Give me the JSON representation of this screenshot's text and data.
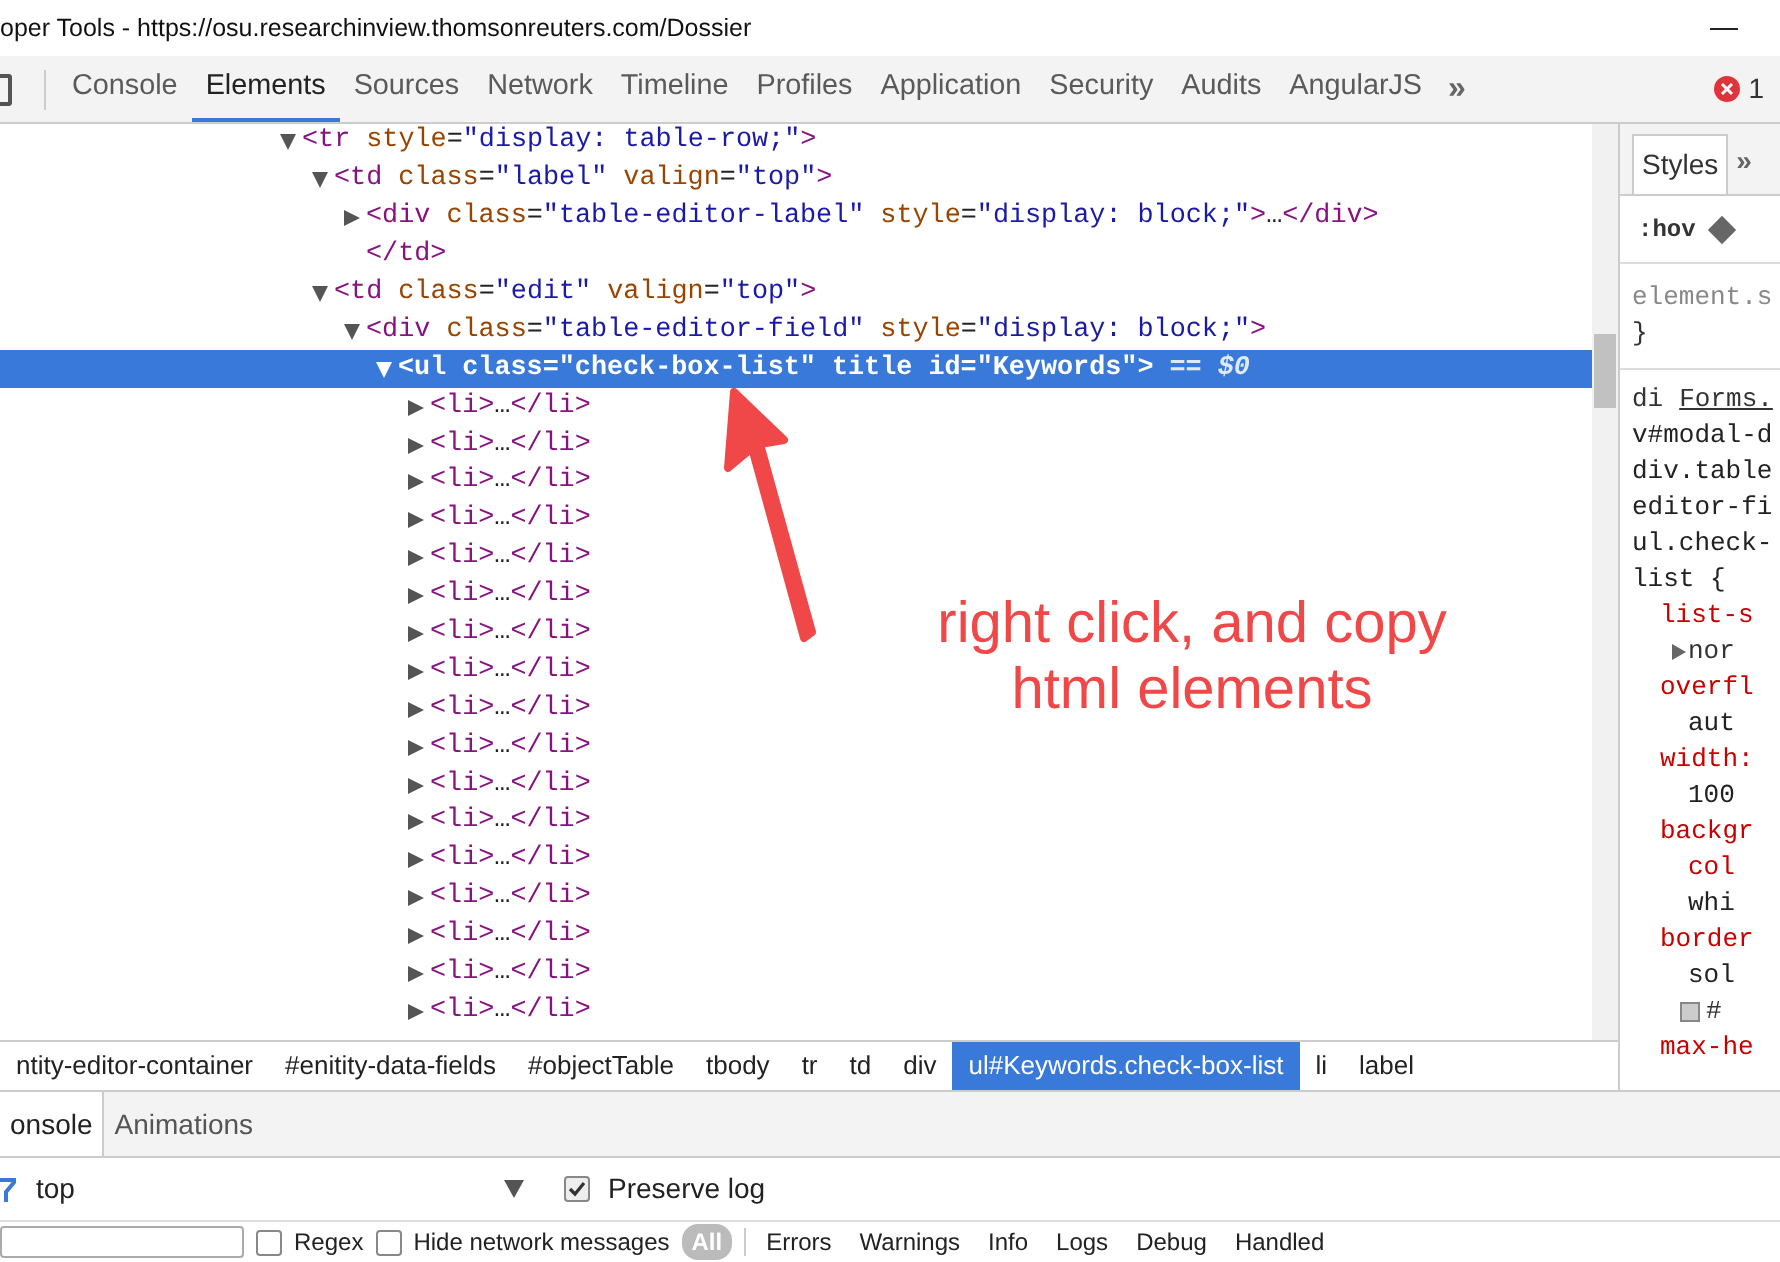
{
  "window": {
    "title": "oper Tools - https://osu.researchinview.thomsonreuters.com/Dossier"
  },
  "tabs": [
    {
      "label": "Console",
      "selected": false
    },
    {
      "label": "Elements",
      "selected": true
    },
    {
      "label": "Sources",
      "selected": false
    },
    {
      "label": "Network",
      "selected": false
    },
    {
      "label": "Timeline",
      "selected": false
    },
    {
      "label": "Profiles",
      "selected": false
    },
    {
      "label": "Application",
      "selected": false
    },
    {
      "label": "Security",
      "selected": false
    },
    {
      "label": "Audits",
      "selected": false
    },
    {
      "label": "AngularJS",
      "selected": false
    }
  ],
  "tabs_overflow": "»",
  "error_count": "1",
  "dom_tree": [
    {
      "expanded": true,
      "selected": false,
      "tokens": [
        {
          "kind": "tag",
          "text": "<tr"
        },
        {
          "kind": "attr",
          "text": " style"
        },
        {
          "kind": "punct",
          "text": "="
        },
        {
          "kind": "value",
          "text": "\"display: table-row;\""
        },
        {
          "kind": "tag",
          "text": ">"
        }
      ],
      "children": [
        {
          "expanded": true,
          "selected": false,
          "tokens": [
            {
              "kind": "tag",
              "text": "<td"
            },
            {
              "kind": "attr",
              "text": " class"
            },
            {
              "kind": "punct",
              "text": "="
            },
            {
              "kind": "value",
              "text": "\"label\""
            },
            {
              "kind": "attr",
              "text": " valign"
            },
            {
              "kind": "punct",
              "text": "="
            },
            {
              "kind": "value",
              "text": "\"top\""
            },
            {
              "kind": "tag",
              "text": ">"
            }
          ],
          "children": [
            {
              "expanded": false,
              "selected": false,
              "tokens": [
                {
                  "kind": "tag",
                  "text": "<div"
                },
                {
                  "kind": "attr",
                  "text": " class"
                },
                {
                  "kind": "punct",
                  "text": "="
                },
                {
                  "kind": "value",
                  "text": "\"table-editor-label\""
                },
                {
                  "kind": "attr",
                  "text": " style"
                },
                {
                  "kind": "punct",
                  "text": "="
                },
                {
                  "kind": "value",
                  "text": "\"display: block;\""
                },
                {
                  "kind": "tag",
                  "text": ">"
                },
                {
                  "kind": "text",
                  "text": "…"
                },
                {
                  "kind": "tag",
                  "text": "</div>"
                }
              ]
            },
            {
              "selected": false,
              "tokens": [
                {
                  "kind": "tag",
                  "text": "</td>"
                }
              ]
            }
          ]
        },
        {
          "expanded": true,
          "selected": false,
          "tokens": [
            {
              "kind": "tag",
              "text": "<td"
            },
            {
              "kind": "attr",
              "text": " class"
            },
            {
              "kind": "punct",
              "text": "="
            },
            {
              "kind": "value",
              "text": "\"edit\""
            },
            {
              "kind": "attr",
              "text": " valign"
            },
            {
              "kind": "punct",
              "text": "="
            },
            {
              "kind": "value",
              "text": "\"top\""
            },
            {
              "kind": "tag",
              "text": ">"
            }
          ],
          "children": [
            {
              "expanded": true,
              "selected": false,
              "tokens": [
                {
                  "kind": "tag",
                  "text": "<div"
                },
                {
                  "kind": "attr",
                  "text": " class"
                },
                {
                  "kind": "punct",
                  "text": "="
                },
                {
                  "kind": "value",
                  "text": "\"table-editor-field\""
                },
                {
                  "kind": "attr",
                  "text": " style"
                },
                {
                  "kind": "punct",
                  "text": "="
                },
                {
                  "kind": "value",
                  "text": "\"display: block;\""
                },
                {
                  "kind": "tag",
                  "text": ">"
                }
              ],
              "children": [
                {
                  "expanded": true,
                  "selected": true,
                  "tokens": [
                    {
                      "kind": "tag",
                      "text": "<ul"
                    },
                    {
                      "kind": "attr",
                      "text": " class"
                    },
                    {
                      "kind": "punct",
                      "text": "="
                    },
                    {
                      "kind": "value",
                      "text": "\"check-box-list\""
                    },
                    {
                      "kind": "attr",
                      "text": " title id"
                    },
                    {
                      "kind": "punct",
                      "text": "="
                    },
                    {
                      "kind": "value",
                      "text": "\"Keywords\""
                    },
                    {
                      "kind": "tag",
                      "text": ">"
                    },
                    {
                      "kind": "ghost",
                      "text": " == $0"
                    }
                  ],
                  "children": [
                    {
                      "expanded": false,
                      "selected": false,
                      "tokens": [
                        {
                          "kind": "tag",
                          "text": "<li>"
                        },
                        {
                          "kind": "text",
                          "text": "…"
                        },
                        {
                          "kind": "tag",
                          "text": "</li>"
                        }
                      ]
                    },
                    {
                      "expanded": false,
                      "selected": false,
                      "tokens": [
                        {
                          "kind": "tag",
                          "text": "<li>"
                        },
                        {
                          "kind": "text",
                          "text": "…"
                        },
                        {
                          "kind": "tag",
                          "text": "</li>"
                        }
                      ]
                    },
                    {
                      "expanded": false,
                      "selected": false,
                      "tokens": [
                        {
                          "kind": "tag",
                          "text": "<li>"
                        },
                        {
                          "kind": "text",
                          "text": "…"
                        },
                        {
                          "kind": "tag",
                          "text": "</li>"
                        }
                      ]
                    },
                    {
                      "expanded": false,
                      "selected": false,
                      "tokens": [
                        {
                          "kind": "tag",
                          "text": "<li>"
                        },
                        {
                          "kind": "text",
                          "text": "…"
                        },
                        {
                          "kind": "tag",
                          "text": "</li>"
                        }
                      ]
                    },
                    {
                      "expanded": false,
                      "selected": false,
                      "tokens": [
                        {
                          "kind": "tag",
                          "text": "<li>"
                        },
                        {
                          "kind": "text",
                          "text": "…"
                        },
                        {
                          "kind": "tag",
                          "text": "</li>"
                        }
                      ]
                    },
                    {
                      "expanded": false,
                      "selected": false,
                      "tokens": [
                        {
                          "kind": "tag",
                          "text": "<li>"
                        },
                        {
                          "kind": "text",
                          "text": "…"
                        },
                        {
                          "kind": "tag",
                          "text": "</li>"
                        }
                      ]
                    },
                    {
                      "expanded": false,
                      "selected": false,
                      "tokens": [
                        {
                          "kind": "tag",
                          "text": "<li>"
                        },
                        {
                          "kind": "text",
                          "text": "…"
                        },
                        {
                          "kind": "tag",
                          "text": "</li>"
                        }
                      ]
                    },
                    {
                      "expanded": false,
                      "selected": false,
                      "tokens": [
                        {
                          "kind": "tag",
                          "text": "<li>"
                        },
                        {
                          "kind": "text",
                          "text": "…"
                        },
                        {
                          "kind": "tag",
                          "text": "</li>"
                        }
                      ]
                    },
                    {
                      "expanded": false,
                      "selected": false,
                      "tokens": [
                        {
                          "kind": "tag",
                          "text": "<li>"
                        },
                        {
                          "kind": "text",
                          "text": "…"
                        },
                        {
                          "kind": "tag",
                          "text": "</li>"
                        }
                      ]
                    },
                    {
                      "expanded": false,
                      "selected": false,
                      "tokens": [
                        {
                          "kind": "tag",
                          "text": "<li>"
                        },
                        {
                          "kind": "text",
                          "text": "…"
                        },
                        {
                          "kind": "tag",
                          "text": "</li>"
                        }
                      ]
                    },
                    {
                      "expanded": false,
                      "selected": false,
                      "tokens": [
                        {
                          "kind": "tag",
                          "text": "<li>"
                        },
                        {
                          "kind": "text",
                          "text": "…"
                        },
                        {
                          "kind": "tag",
                          "text": "</li>"
                        }
                      ]
                    },
                    {
                      "expanded": false,
                      "selected": false,
                      "tokens": [
                        {
                          "kind": "tag",
                          "text": "<li>"
                        },
                        {
                          "kind": "text",
                          "text": "…"
                        },
                        {
                          "kind": "tag",
                          "text": "</li>"
                        }
                      ]
                    },
                    {
                      "expanded": false,
                      "selected": false,
                      "tokens": [
                        {
                          "kind": "tag",
                          "text": "<li>"
                        },
                        {
                          "kind": "text",
                          "text": "…"
                        },
                        {
                          "kind": "tag",
                          "text": "</li>"
                        }
                      ]
                    },
                    {
                      "expanded": false,
                      "selected": false,
                      "tokens": [
                        {
                          "kind": "tag",
                          "text": "<li>"
                        },
                        {
                          "kind": "text",
                          "text": "…"
                        },
                        {
                          "kind": "tag",
                          "text": "</li>"
                        }
                      ]
                    },
                    {
                      "expanded": false,
                      "selected": false,
                      "tokens": [
                        {
                          "kind": "tag",
                          "text": "<li>"
                        },
                        {
                          "kind": "text",
                          "text": "…"
                        },
                        {
                          "kind": "tag",
                          "text": "</li>"
                        }
                      ]
                    },
                    {
                      "expanded": false,
                      "selected": false,
                      "tokens": [
                        {
                          "kind": "tag",
                          "text": "<li>"
                        },
                        {
                          "kind": "text",
                          "text": "…"
                        },
                        {
                          "kind": "tag",
                          "text": "</li>"
                        }
                      ]
                    },
                    {
                      "expanded": false,
                      "selected": false,
                      "tokens": [
                        {
                          "kind": "tag",
                          "text": "<li>"
                        },
                        {
                          "kind": "text",
                          "text": "…"
                        },
                        {
                          "kind": "tag",
                          "text": "</li>"
                        }
                      ]
                    }
                  ]
                }
              ]
            }
          ]
        }
      ]
    }
  ],
  "annotation": {
    "text": "right click, and copy html elements"
  },
  "breadcrumbs": [
    {
      "label": "ntity-editor-container",
      "selected": false
    },
    {
      "label": "#enitity-data-fields",
      "selected": false
    },
    {
      "label": "#objectTable",
      "selected": false
    },
    {
      "label": "tbody",
      "selected": false
    },
    {
      "label": "tr",
      "selected": false
    },
    {
      "label": "td",
      "selected": false
    },
    {
      "label": "div",
      "selected": false
    },
    {
      "label": "ul#Keywords.check-box-list",
      "selected": true
    },
    {
      "label": "li",
      "selected": false
    },
    {
      "label": "label",
      "selected": false
    }
  ],
  "styles_pane": {
    "tabs": [
      {
        "label": "Styles",
        "selected": true
      }
    ],
    "tabs_overflow": "»",
    "hov": ":hov",
    "lines": [
      {
        "kind": "selector",
        "text": "element.s"
      },
      {
        "kind": "brace",
        "text": "}"
      },
      {
        "kind": "source",
        "text": "di",
        "link": "Forms."
      },
      {
        "kind": "selector",
        "text": "v#modal-d"
      },
      {
        "kind": "selector",
        "text": "div.table"
      },
      {
        "kind": "selector",
        "text": "editor-fi"
      },
      {
        "kind": "selector",
        "text": "ul.check-"
      },
      {
        "kind": "selector",
        "text": "list {"
      },
      {
        "kind": "prop",
        "text": "list-s"
      },
      {
        "kind": "value_expand",
        "text": "nor"
      },
      {
        "kind": "prop",
        "text": "overfl"
      },
      {
        "kind": "value",
        "text": "aut"
      },
      {
        "kind": "prop",
        "text": "width:"
      },
      {
        "kind": "value",
        "text": "100"
      },
      {
        "kind": "prop",
        "text": "backgr"
      },
      {
        "kind": "prop_cont",
        "text": "col"
      },
      {
        "kind": "value",
        "text": "whi"
      },
      {
        "kind": "prop",
        "text": "border"
      },
      {
        "kind": "value",
        "text": "sol"
      },
      {
        "kind": "value_swatch",
        "text": "#"
      },
      {
        "kind": "prop",
        "text": "max-he"
      }
    ]
  },
  "drawer": {
    "tabs": [
      {
        "label": "onsole",
        "selected": true
      },
      {
        "label": "Animations",
        "selected": false
      }
    ],
    "context": "top",
    "preserve_log": {
      "label": "Preserve log",
      "checked": true
    },
    "filter": {
      "regex": {
        "label": "Regex",
        "checked": false
      },
      "hide_network": {
        "label": "Hide network messages",
        "checked": false
      },
      "all": "All",
      "levels": [
        "Errors",
        "Warnings",
        "Info",
        "Logs",
        "Debug",
        "Handled"
      ]
    }
  }
}
